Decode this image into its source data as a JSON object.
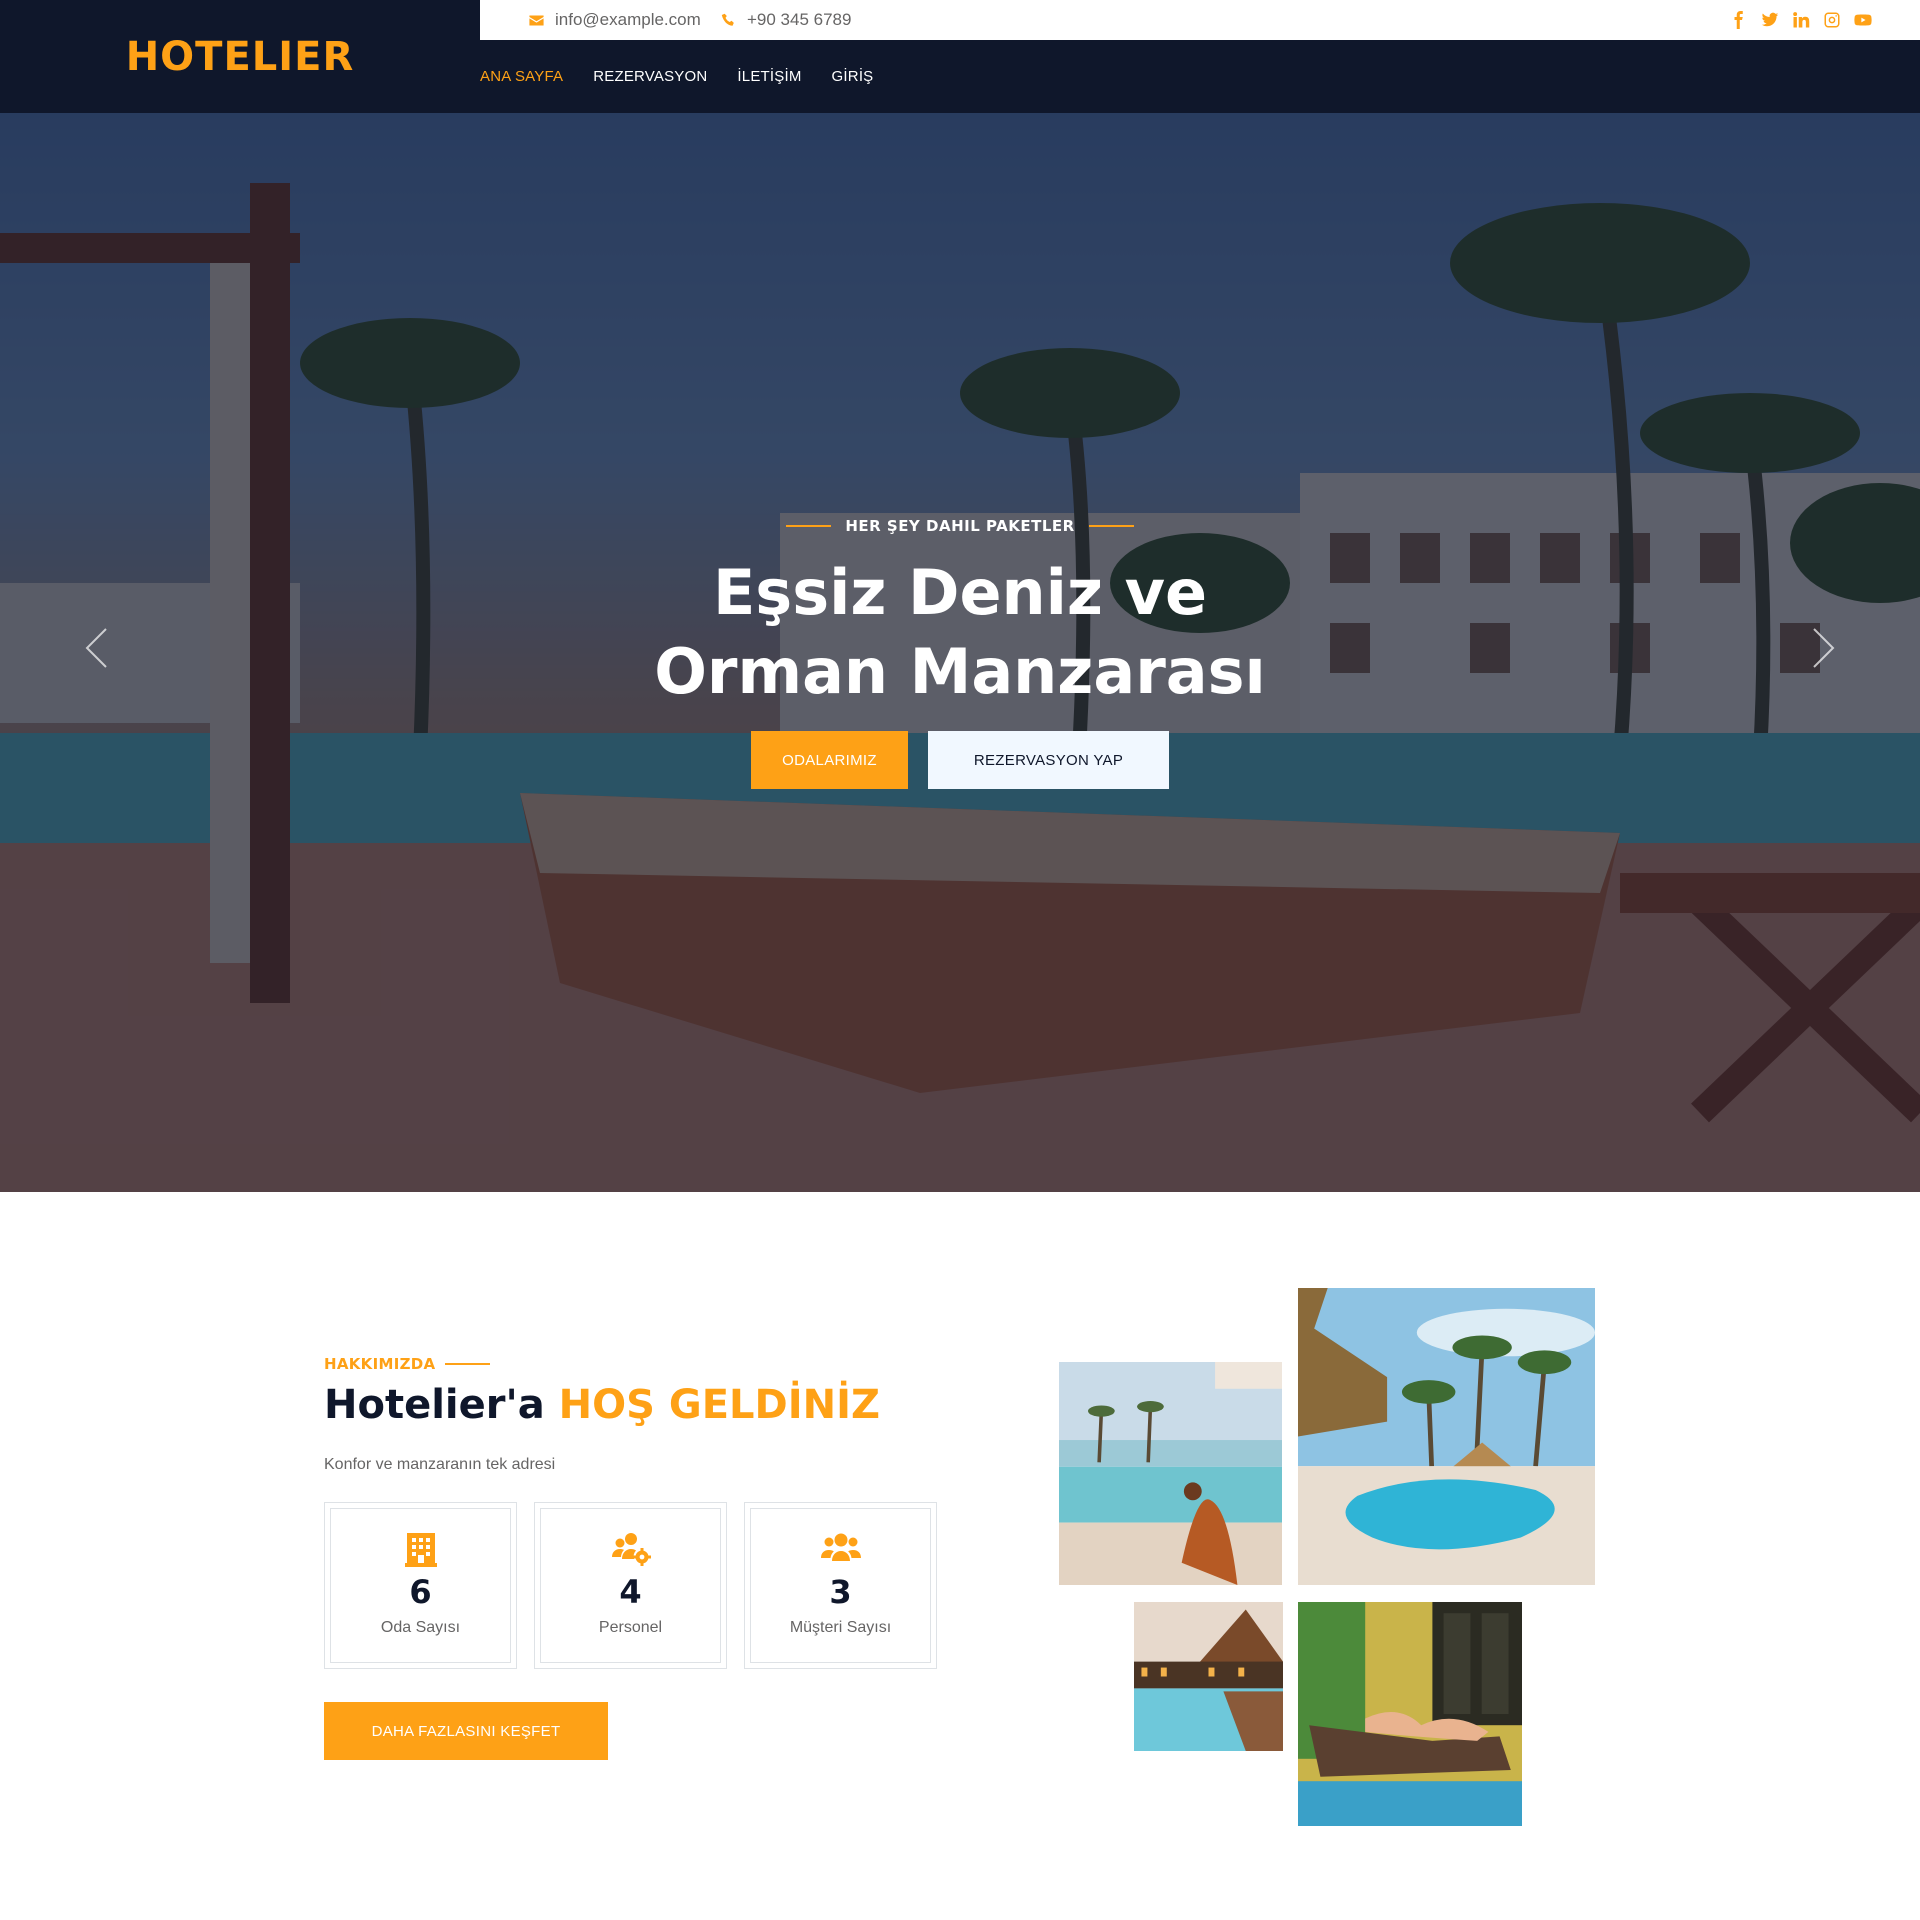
{
  "brand": {
    "name": "HOTELIER"
  },
  "topbar": {
    "email": "info@example.com",
    "phone": "+90 345 6789",
    "socials": [
      "facebook-icon",
      "twitter-icon",
      "linkedin-icon",
      "instagram-icon",
      "youtube-icon"
    ]
  },
  "nav": {
    "items": [
      {
        "label": "ANA SAYFA",
        "active": true
      },
      {
        "label": "REZERVASYON"
      },
      {
        "label": "İLETİŞİM"
      },
      {
        "label": "GİRİŞ"
      }
    ]
  },
  "hero": {
    "tagline": "HER ŞEY DAHIL PAKETLER",
    "title_line1": "Eşsiz Deniz ve",
    "title_line2": "Orman Manzarası",
    "primary_button": "ODALARIMIZ",
    "secondary_button": "REZERVASYON YAP"
  },
  "about": {
    "label": "HAKKIMIZDA",
    "title_prefix": "Hotelier'a",
    "title_accent": "HOŞ GELDİNİZ",
    "text": "Konfor ve manzaranın tek adresi",
    "stats": [
      {
        "icon": "hotel-icon",
        "value": "6",
        "label": "Oda Sayısı"
      },
      {
        "icon": "users-cog-icon",
        "value": "4",
        "label": "Personel"
      },
      {
        "icon": "users-icon",
        "value": "3",
        "label": "Müşteri Sayısı"
      }
    ],
    "cta": "DAHA FAZLASINI KEŞFET"
  },
  "colors": {
    "accent": "#fea116",
    "dark": "#0f172b",
    "light": "#f1f8ff",
    "text": "#666565"
  }
}
